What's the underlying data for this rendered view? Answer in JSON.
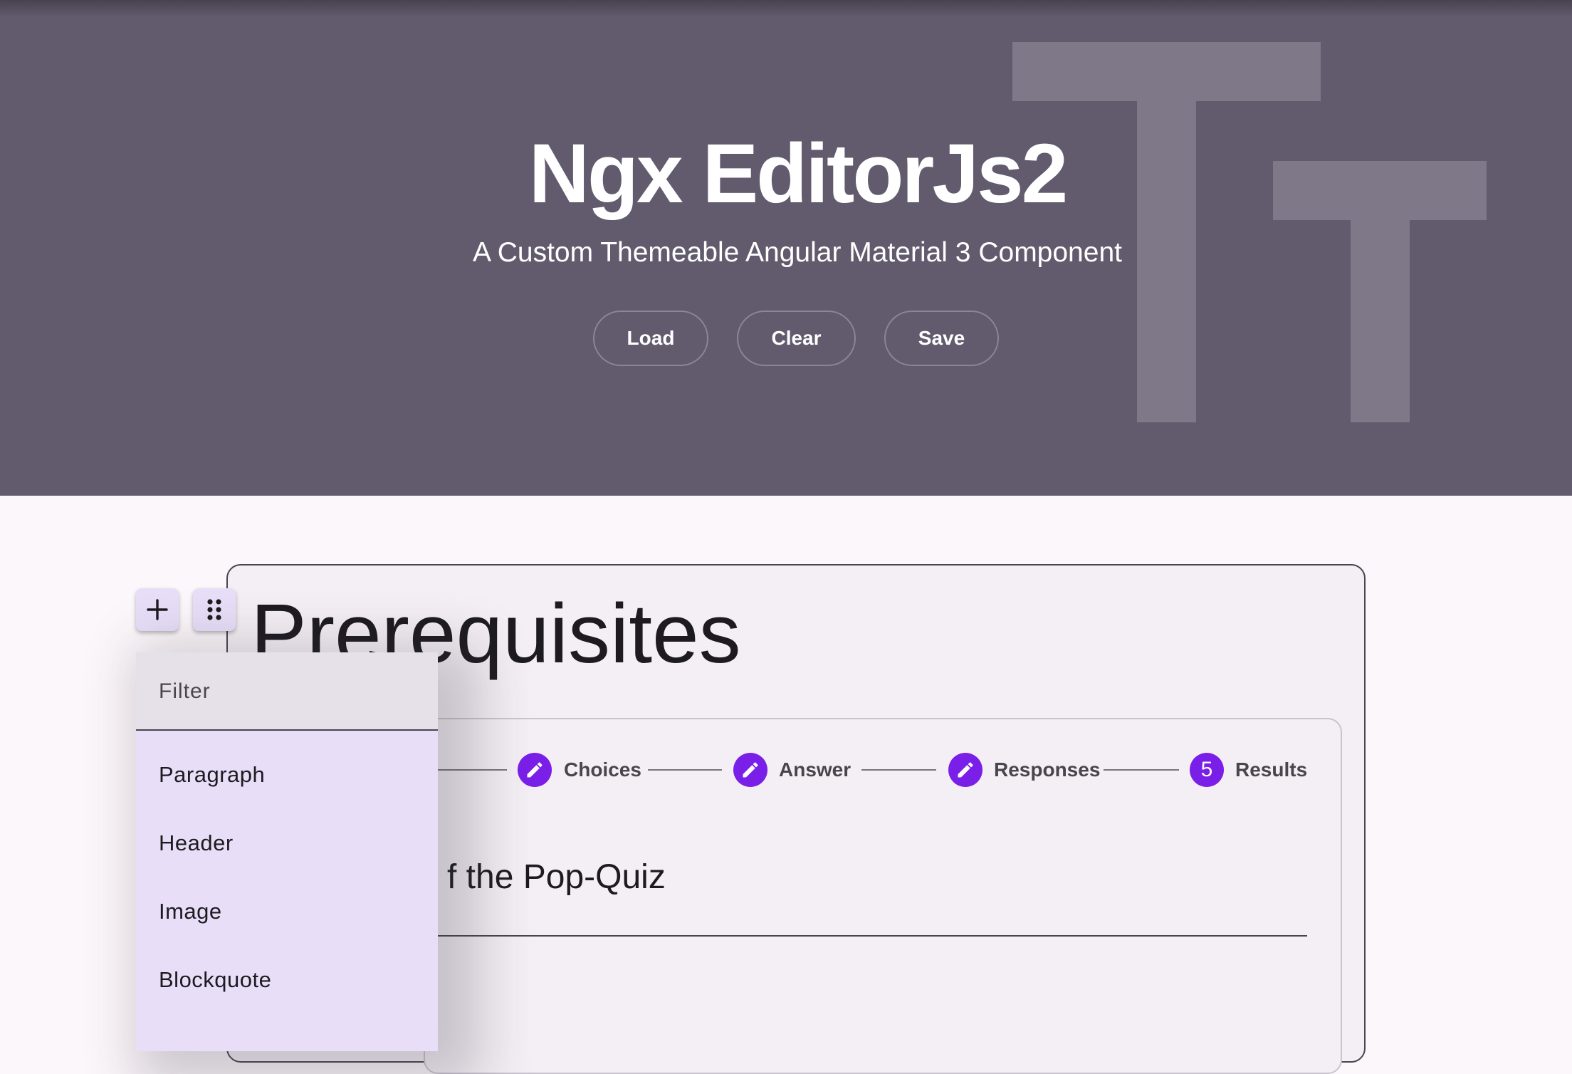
{
  "hero": {
    "title": "Ngx EditorJs2",
    "subtitle": "A Custom Themeable Angular Material 3 Component",
    "buttons": {
      "load": "Load",
      "clear": "Clear",
      "save": "Save"
    },
    "background_icon": "text-fields-icon"
  },
  "editor": {
    "block_title": "Prerequisites",
    "stepper": {
      "steps": [
        {
          "label": "Choices",
          "icon": "edit-icon"
        },
        {
          "label": "Answer",
          "icon": "edit-icon"
        },
        {
          "label": "Responses",
          "icon": "edit-icon"
        },
        {
          "label": "Results",
          "number": "5"
        }
      ]
    },
    "quiz_text": "f the Pop-Quiz"
  },
  "toolbar": {
    "add_icon": "plus-icon",
    "drag_icon": "drag-handle-icon"
  },
  "toolbox_menu": {
    "filter_placeholder": "Filter",
    "items": [
      "Paragraph",
      "Header",
      "Image",
      "Blockquote"
    ]
  },
  "colors": {
    "hero_background": "#625b6e",
    "page_background": "#fcf7fa",
    "step_accent": "#7a1fe8",
    "menu_background": "#e8def8"
  }
}
